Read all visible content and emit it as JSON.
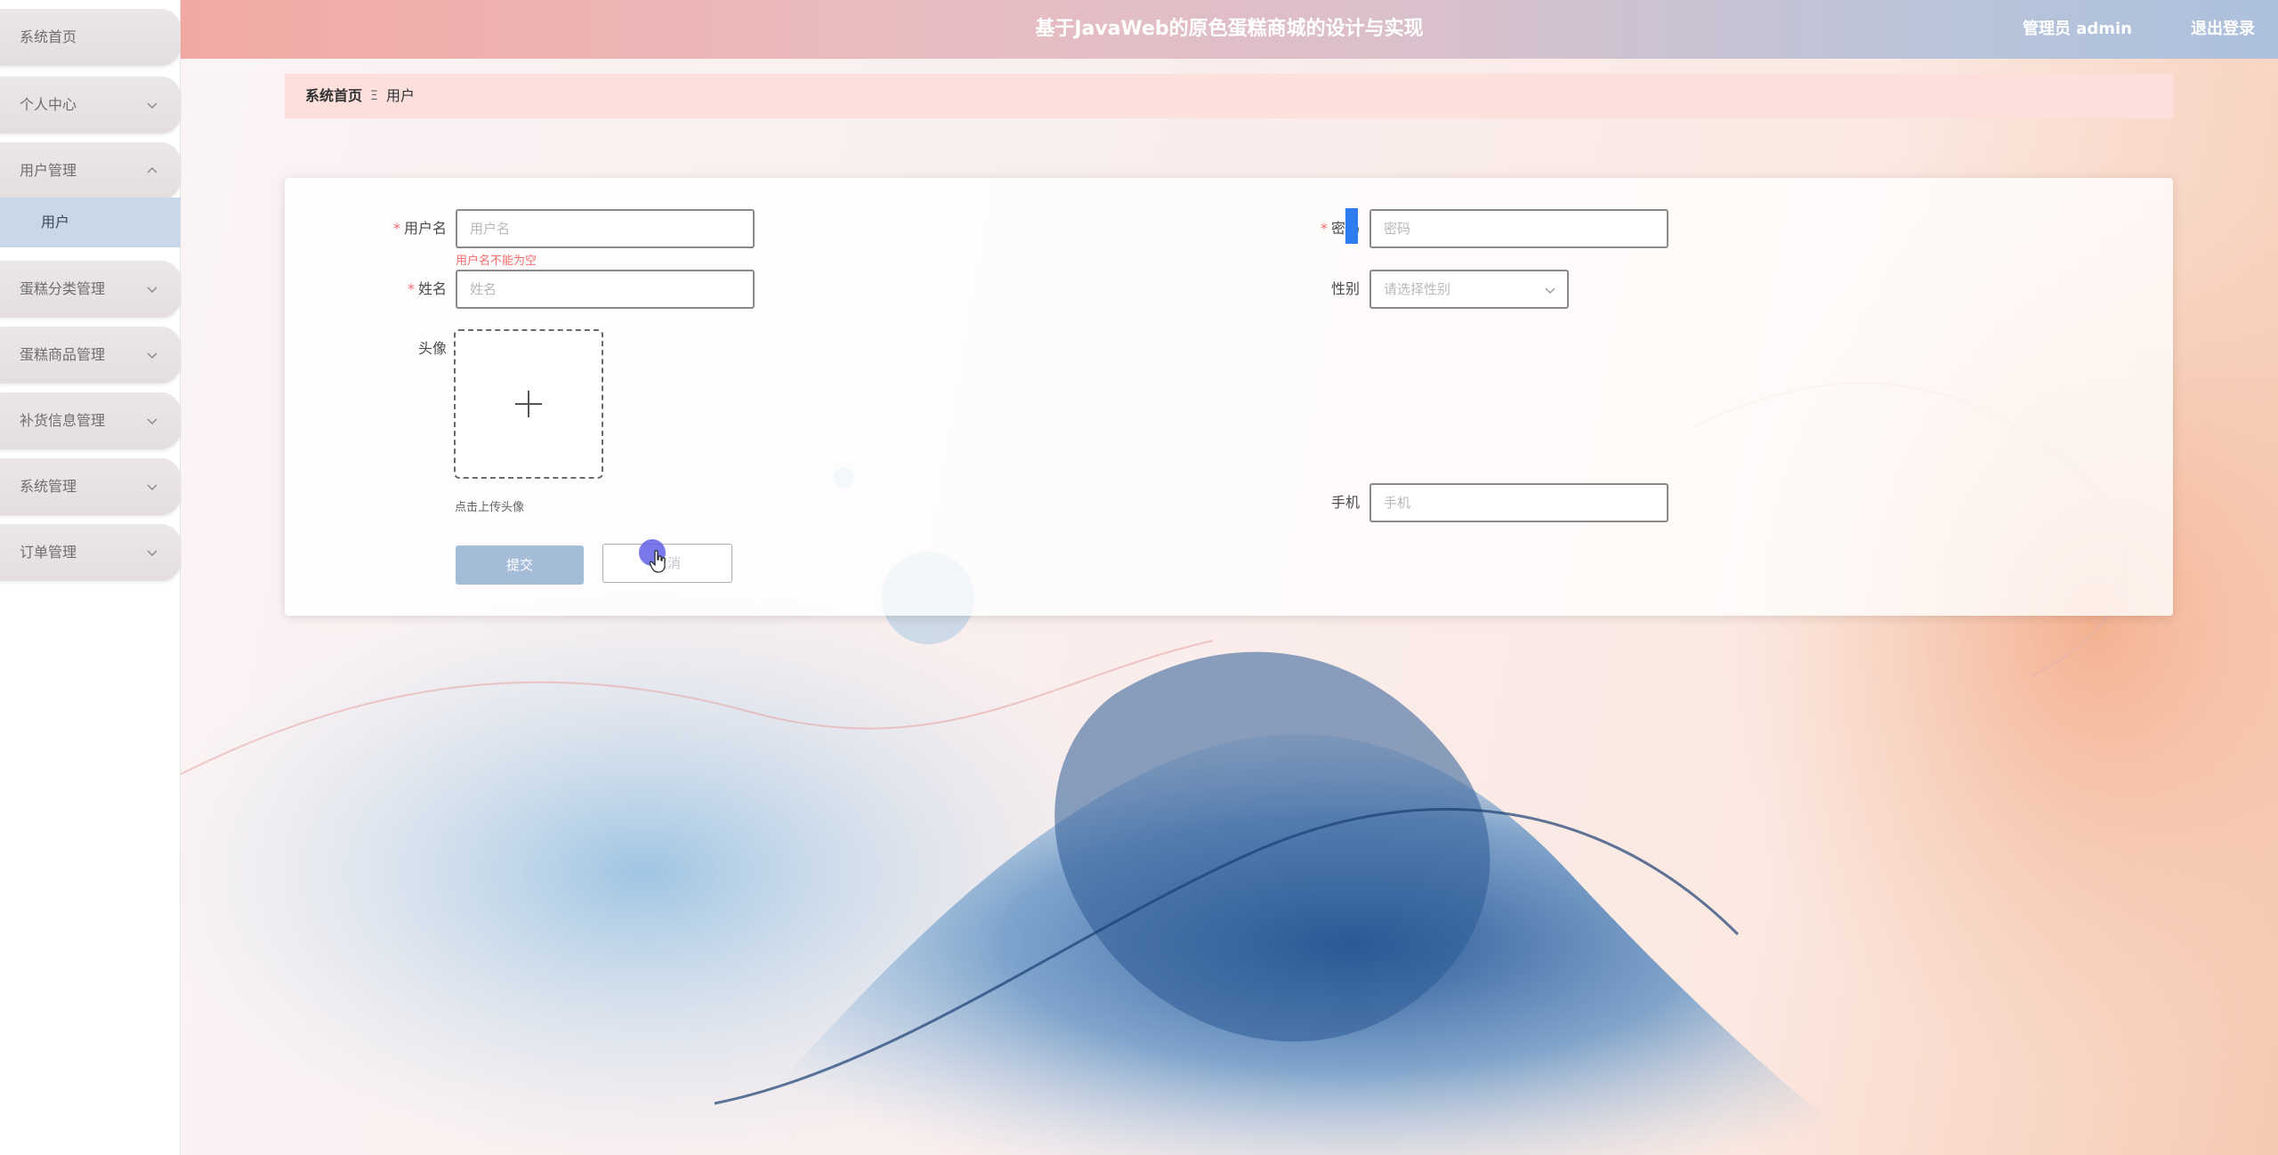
{
  "app": {
    "title": "基于JavaWeb的原色蛋糕商城的设计与实现",
    "user": "管理员 admin",
    "logout": "退出登录"
  },
  "sidebar": {
    "items": [
      {
        "label": "系统首页",
        "expandable": false
      },
      {
        "label": "个人中心",
        "expandable": true,
        "expanded": false
      },
      {
        "label": "用户管理",
        "expandable": true,
        "expanded": true
      },
      {
        "label": "蛋糕分类管理",
        "expandable": true,
        "expanded": false
      },
      {
        "label": "蛋糕商品管理",
        "expandable": true,
        "expanded": false
      },
      {
        "label": "补货信息管理",
        "expandable": true,
        "expanded": false
      },
      {
        "label": "系统管理",
        "expandable": true,
        "expanded": false
      },
      {
        "label": "订单管理",
        "expandable": true,
        "expanded": false
      }
    ],
    "submenu": {
      "label": "用户",
      "active": true
    }
  },
  "breadcrumb": {
    "home": "系统首页",
    "separator": "Ξ",
    "current": "用户"
  },
  "form": {
    "username": {
      "label": "用户名",
      "required": true,
      "value": "",
      "placeholder": "用户名",
      "error": "用户名不能为空"
    },
    "password": {
      "label": "密码",
      "required": true,
      "value": "",
      "placeholder": "密码"
    },
    "name": {
      "label": "姓名",
      "required": true,
      "value": "",
      "placeholder": "姓名"
    },
    "gender": {
      "label": "性别",
      "placeholder": "请选择性别"
    },
    "avatar": {
      "label": "头像",
      "tip": "点击上传头像"
    },
    "phone": {
      "label": "手机",
      "value": "",
      "placeholder": "手机"
    },
    "submit_label": "提交",
    "cancel_label": "取消"
  },
  "colors": {
    "header_start": "#f2a9a3",
    "header_end": "#acc0dc",
    "breadcrumb_bg": "#fde0dc",
    "active_submenu": "#c9d8e8",
    "required": "#f56c6c",
    "submit_button": "#a5bcd9"
  },
  "icons": {
    "menu_chevron": "chevron-down-icon",
    "expanded_chevron": "chevron-up-icon",
    "upload": "plus-icon",
    "select": "chevron-down-icon"
  }
}
